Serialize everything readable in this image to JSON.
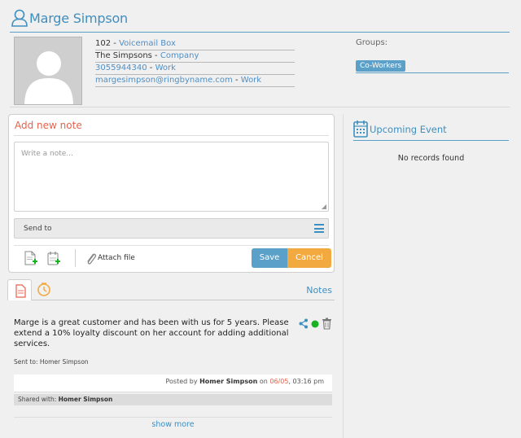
{
  "contact": {
    "name": "Marge Simpson",
    "lines": [
      {
        "value": "102",
        "sep": " - ",
        "label": "Voicemail Box"
      },
      {
        "value": "The Simpsons",
        "sep": " - ",
        "label": "Company"
      },
      {
        "value": "3055944340",
        "sep": " - ",
        "label": "Work"
      },
      {
        "value": "margesimpson@ringbyname.com",
        "sep": " - ",
        "label": "Work"
      }
    ]
  },
  "groups": {
    "label": "Groups:",
    "items": [
      "Co-Workers"
    ]
  },
  "add_note": {
    "title": "Add new note",
    "placeholder": "Write a note...",
    "send_to_label": "Send to",
    "attach_label": "Attach file",
    "save_label": "Save",
    "cancel_label": "Cancel"
  },
  "notes_tab": {
    "label": "Notes"
  },
  "note": {
    "text": "Marge is a great customer and has been with us for 5 years. Please extend a 10% loyalty discount on her account for adding additional services.",
    "sent_to": "Sent to: Homer Simpson",
    "posted_prefix": "Posted by",
    "posted_by": "Homer Simpson",
    "posted_on": "on",
    "posted_date": "06/05",
    "posted_time": ", 03:16 pm",
    "shared_prefix": "Shared with:",
    "shared_with": "Homer Simpson",
    "status_color": "#17b321"
  },
  "show_more": "show more",
  "upcoming": {
    "title": "Upcoming Event",
    "empty": "No records found"
  },
  "colors": {
    "accent": "#3d8fc0",
    "note_title": "#e8604a",
    "save": "#5aa0c8",
    "cancel": "#f2a940"
  }
}
